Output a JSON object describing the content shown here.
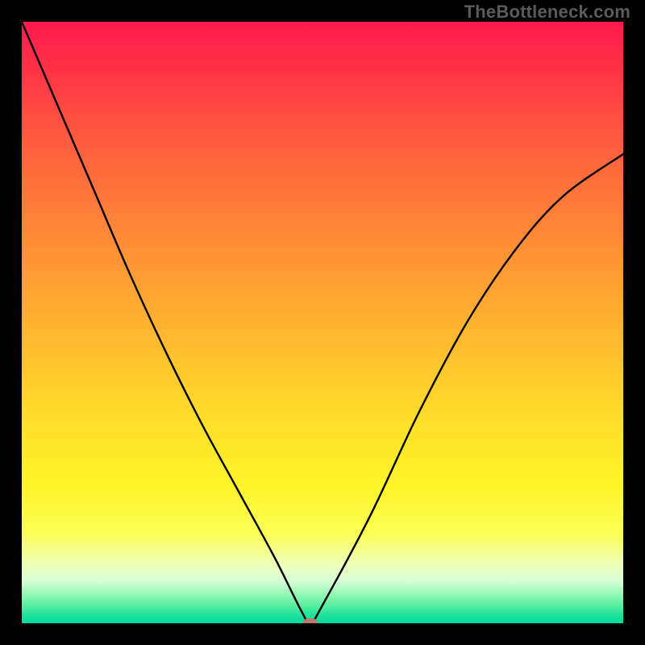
{
  "attribution": "TheBottleneck.com",
  "colors": {
    "background": "#000000",
    "gradient_top": "#ff1a4d",
    "gradient_bottom": "#00da9c",
    "curve": "#000000",
    "marker": "#c07a6c",
    "attribution_text": "#5b5b5b"
  },
  "chart_data": {
    "type": "line",
    "title": "",
    "xlabel": "",
    "ylabel": "",
    "xlim": [
      0,
      100
    ],
    "ylim": [
      0,
      100
    ],
    "grid": false,
    "legend": false,
    "annotations": [],
    "x": [
      0,
      6,
      12,
      18,
      24,
      30,
      36,
      42,
      46.5,
      48,
      50,
      58,
      66,
      74,
      82,
      90,
      100
    ],
    "values": [
      100,
      86,
      72,
      58,
      45,
      33,
      22,
      11,
      2,
      0,
      3,
      18,
      35,
      50,
      62,
      71,
      78
    ],
    "marker": {
      "x": 48,
      "y": 0
    }
  }
}
